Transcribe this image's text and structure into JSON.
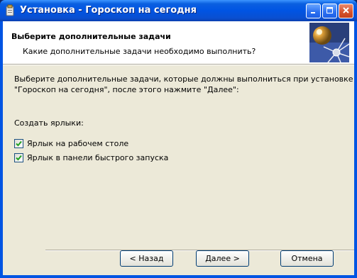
{
  "window": {
    "title": "Установка - Гороскоп на сегодня",
    "controls": {
      "minimize": "minimize-icon",
      "maximize": "maximize-icon",
      "close": "close-icon"
    }
  },
  "header": {
    "title": "Выберите дополнительные задачи",
    "subtitle": "Какие дополнительные задачи необходимо выполнить?",
    "image": "wizard-graphic"
  },
  "body": {
    "description_line1": "Выберите дополнительные задачи, которые должны выполниться при установке",
    "description_line2": "\"Гороскоп на сегодня\", после этого нажмите \"Далее\":",
    "section_label": "Создать ярлыки:",
    "tasks": [
      {
        "label": "Ярлык на рабочем столе",
        "checked": true
      },
      {
        "label": "Ярлык в панели быстрого запуска",
        "checked": true
      }
    ]
  },
  "buttons": {
    "back": "< Назад",
    "next": "Далее >",
    "cancel": "Отмена"
  },
  "colors": {
    "titlebar": "#0054e3",
    "face": "#ece9d8",
    "checkmark": "#21a121"
  }
}
